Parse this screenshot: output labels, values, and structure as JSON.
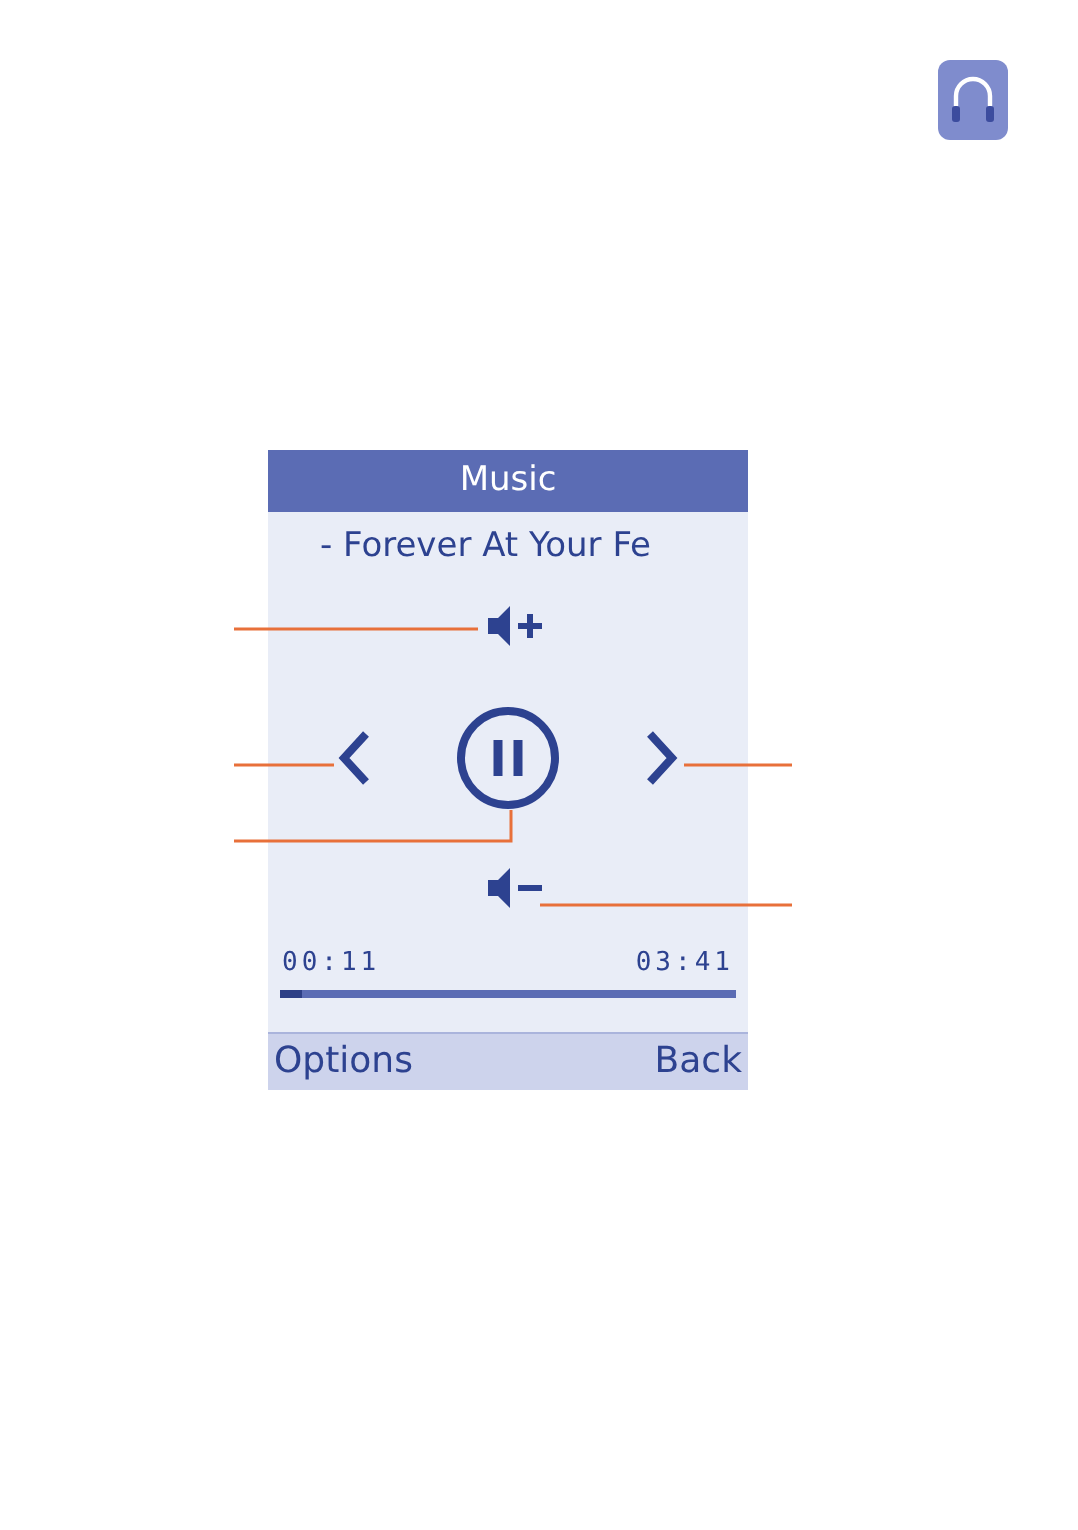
{
  "screen": {
    "title": "Music",
    "track": "- Forever At Your Fe",
    "playing": true,
    "elapsed": "00:11",
    "duration": "03:41",
    "progress": {
      "level": 0.05
    }
  },
  "soft_keys": [
    {
      "label": "Options"
    },
    {
      "label": "Back"
    }
  ]
}
